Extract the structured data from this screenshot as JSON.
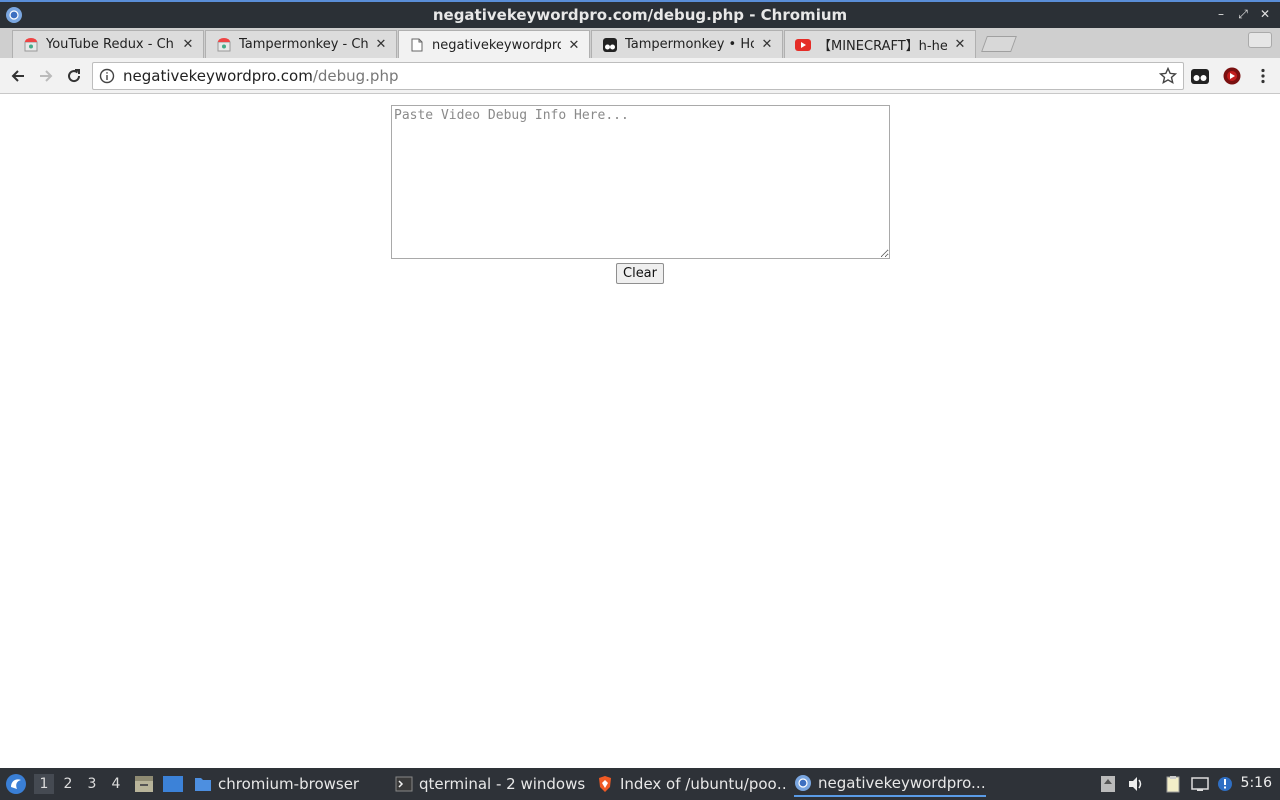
{
  "window": {
    "title": "negativekeywordpro.com/debug.php - Chromium"
  },
  "tabs": [
    {
      "title": "YouTube Redux - Chr",
      "favicon": "chrome-webstore-icon"
    },
    {
      "title": "Tampermonkey - Ch",
      "favicon": "chrome-webstore-icon"
    },
    {
      "title": "negativekeywordpro",
      "favicon": "page-icon"
    },
    {
      "title": "Tampermonkey • Ho",
      "favicon": "tampermonkey-icon"
    },
    {
      "title": "【MINECRAFT】h-hev",
      "favicon": "youtube-icon"
    }
  ],
  "address": {
    "host": "negativekeywordpro.com",
    "path": "/debug.php"
  },
  "page": {
    "textarea_placeholder": "Paste Video Debug Info Here...",
    "clear_label": "Clear"
  },
  "taskbar": {
    "workspaces": [
      "1",
      "2",
      "3",
      "4"
    ],
    "tasks": [
      {
        "label": "chromium-browser",
        "icon": "folder-icon"
      },
      {
        "label": "qterminal - 2 windows",
        "icon": "terminal-icon"
      },
      {
        "label": "Index of /ubuntu/poo…",
        "icon": "brave-icon"
      },
      {
        "label": "negativekeywordpro.…",
        "icon": "chromium-icon"
      }
    ],
    "clock": "5:16"
  },
  "colors": {
    "accent": "#5a9be6",
    "titlebar": "#2b3036",
    "taskbar": "#2e3238"
  }
}
